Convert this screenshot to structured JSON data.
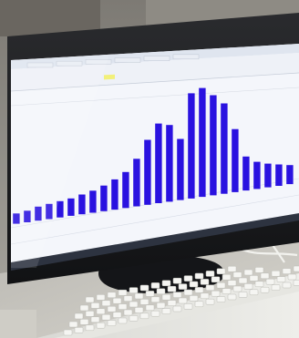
{
  "scene": {
    "subject": "monitor-displaying-bar-chart",
    "chart_color": "#2a12e0",
    "screen_color": "#f4f6fb"
  },
  "screen_ui": {
    "highlight_color": "#f2f07a",
    "tabs": [
      "",
      "",
      "",
      "",
      "",
      ""
    ]
  },
  "chart_data": {
    "type": "bar",
    "bar_heights": [
      0.08,
      0.09,
      0.11,
      0.12,
      0.13,
      0.14,
      0.16,
      0.18,
      0.21,
      0.25,
      0.3,
      0.4,
      0.55,
      0.68,
      0.66,
      0.53,
      0.92,
      0.96,
      0.89,
      0.81,
      0.57,
      0.31,
      0.25,
      0.22,
      0.2,
      0.18
    ]
  }
}
